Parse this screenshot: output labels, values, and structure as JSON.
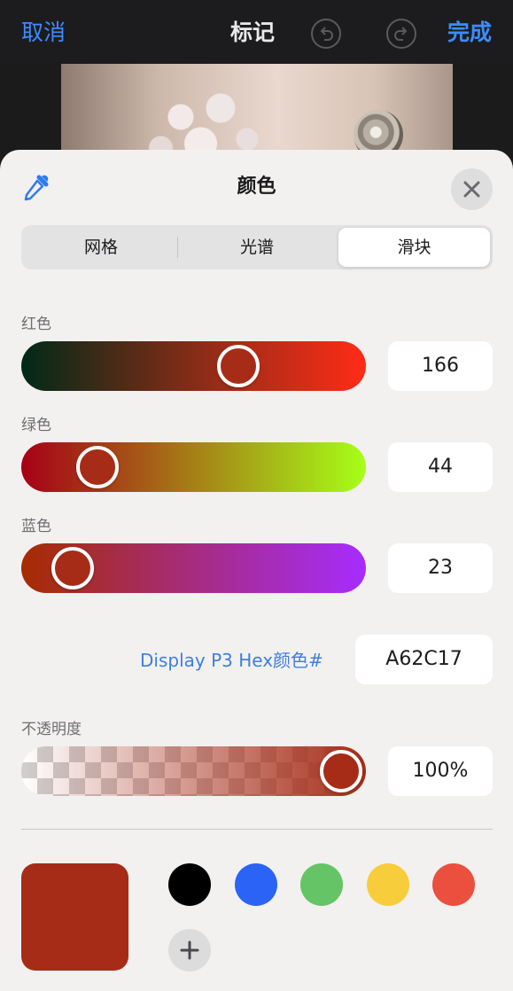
{
  "nav": {
    "cancel": "取消",
    "title": "标记",
    "done": "完成",
    "undo_icon": "undo-icon",
    "redo_icon": "redo-icon"
  },
  "sheet": {
    "title": "颜色",
    "eyedropper_icon": "eyedropper-icon",
    "close_icon": "close-icon",
    "tabs": [
      {
        "label": "网格",
        "selected": false
      },
      {
        "label": "光谱",
        "selected": false
      },
      {
        "label": "滑块",
        "selected": true
      }
    ],
    "sliders": {
      "red": {
        "label": "红色",
        "value": "166",
        "level": 0.651
      },
      "green": {
        "label": "绿色",
        "value": "44",
        "level": 0.173
      },
      "blue": {
        "label": "蓝色",
        "value": "23",
        "level": 0.09
      }
    },
    "hex": {
      "label": "Display P3 Hex颜色#",
      "value": "A62C17"
    },
    "opacity": {
      "label": "不透明度",
      "value": "100%",
      "level": 1.0
    },
    "current_color": "#a62c17",
    "swatches": [
      "#000000",
      "#2a63f5",
      "#65c466",
      "#f8cd3b",
      "#eb4f3d"
    ],
    "add_icon": "plus-icon"
  }
}
